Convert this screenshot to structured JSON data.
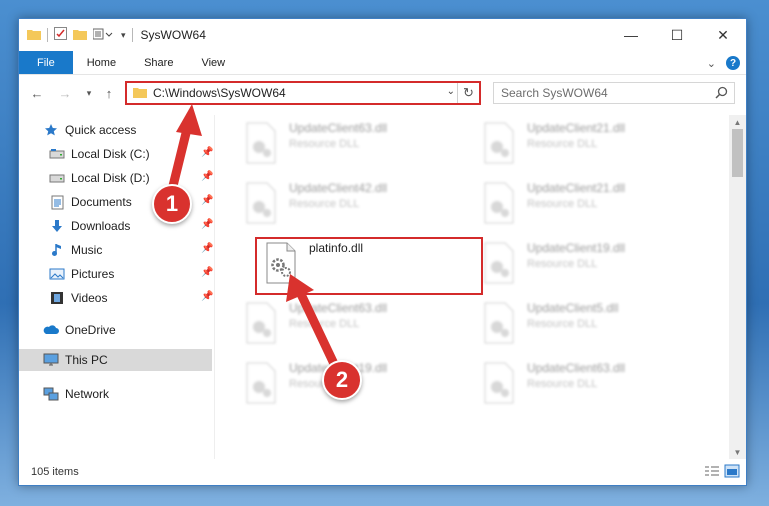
{
  "window": {
    "title": "SysWOW64",
    "controls": {
      "minimize": "—",
      "maximize": "☐",
      "close": "✕"
    }
  },
  "ribbon": {
    "tabs": [
      "File",
      "Home",
      "Share",
      "View"
    ]
  },
  "navbar": {
    "address": "C:\\Windows\\SysWOW64",
    "search_placeholder": "Search SysWOW64"
  },
  "sidebar": {
    "items": [
      {
        "label": "Quick access",
        "icon": "star-icon"
      },
      {
        "label": "Local Disk (C:)",
        "icon": "drive-icon",
        "pinned": true
      },
      {
        "label": "Local Disk (D:)",
        "icon": "drive-icon",
        "pinned": true
      },
      {
        "label": "Documents",
        "icon": "documents-icon",
        "pinned": true
      },
      {
        "label": "Downloads",
        "icon": "download-icon",
        "pinned": true
      },
      {
        "label": "Music",
        "icon": "music-icon",
        "pinned": true
      },
      {
        "label": "Pictures",
        "icon": "pictures-icon",
        "pinned": true
      },
      {
        "label": "Videos",
        "icon": "videos-icon",
        "pinned": true
      },
      {
        "label": "OneDrive",
        "icon": "cloud-icon"
      },
      {
        "label": "This PC",
        "icon": "computer-icon",
        "selected": true
      },
      {
        "label": "Network",
        "icon": "network-icon"
      }
    ]
  },
  "files": [
    {
      "name": "UpdateClient63.dll",
      "type": "Resource DLL"
    },
    {
      "name": "UpdateClient21.dll",
      "type": "Resource DLL"
    },
    {
      "name": "UpdateClient42.dll",
      "type": "Resource DLL"
    },
    {
      "name": "UpdateClient21.dll",
      "type": "Resource DLL"
    },
    {
      "name": "platinfo.dll",
      "type": ""
    },
    {
      "name": "UpdateClient19.dll",
      "type": "Resource DLL"
    },
    {
      "name": "UpdateClient63.dll",
      "type": "Resource DLL"
    },
    {
      "name": "UpdateClient5.dll",
      "type": "Resource DLL"
    },
    {
      "name": "UpdateClient19.dll",
      "type": "Resource DLL"
    },
    {
      "name": "UpdateClient63.dll",
      "type": "Resource DLL"
    }
  ],
  "status": {
    "count": "105 items"
  },
  "annotations": {
    "step1": "1",
    "step2": "2"
  },
  "colors": {
    "accent": "#1979ca",
    "highlight": "#d42b2b",
    "badge": "#d9322e"
  }
}
